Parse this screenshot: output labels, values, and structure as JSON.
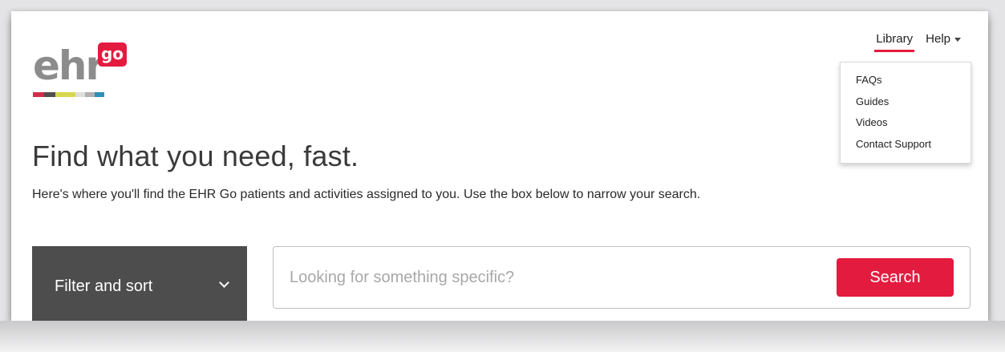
{
  "brand": {
    "logo_text": "ehr",
    "logo_badge": "go",
    "accent_color": "#e31b3f",
    "stripe_colors": [
      "#cf2f4b",
      "#4f4f4f",
      "#d7d74f",
      "#dedede",
      "#b0b0b0",
      "#2f8fb5"
    ]
  },
  "nav": {
    "library_label": "Library",
    "help_label": "Help",
    "help_menu": {
      "items": [
        "FAQs",
        "Guides",
        "Videos",
        "Contact Support"
      ]
    }
  },
  "main": {
    "title": "Find what you need, fast.",
    "subtitle": "Here's where you'll find the EHR Go patients and activities assigned to you. Use the box below to narrow your search."
  },
  "filter": {
    "label": "Filter and sort"
  },
  "search": {
    "placeholder": "Looking for something specific?",
    "button_label": "Search"
  }
}
